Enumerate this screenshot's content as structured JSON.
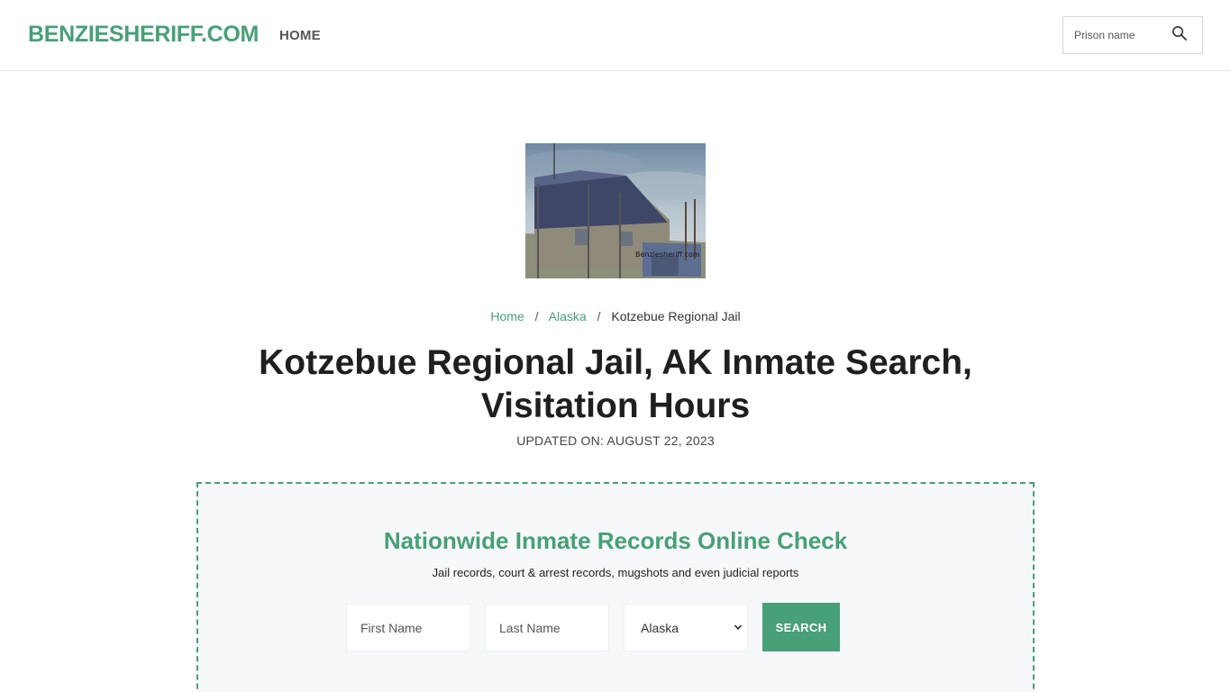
{
  "header": {
    "logo": "BENZIESHERIFF.COM",
    "nav": [
      {
        "label": "HOME"
      }
    ],
    "search": {
      "placeholder": "Prison name",
      "icon": "search-icon"
    }
  },
  "hero_image": {
    "alt": "Kotzebue Regional Jail building",
    "watermark": "Benziesheriff.com"
  },
  "breadcrumb": {
    "items": [
      {
        "label": "Home"
      },
      {
        "label": "Alaska"
      },
      {
        "label": "Kotzebue Regional Jail"
      }
    ],
    "separator": "/"
  },
  "page": {
    "title": "Kotzebue Regional Jail, AK Inmate Search, Visitation Hours",
    "updated": "UPDATED ON: AUGUST 22, 2023"
  },
  "records": {
    "title": "Nationwide Inmate Records Online Check",
    "subtitle": "Jail records, court & arrest records, mugshots and even judicial reports",
    "first_name_placeholder": "First Name",
    "last_name_placeholder": "Last Name",
    "state_selected": "Alaska",
    "submit_label": "SEARCH"
  },
  "colors": {
    "accent": "#47a077",
    "box_bg": "#f6f8f9",
    "title": "#1f1f1f"
  }
}
